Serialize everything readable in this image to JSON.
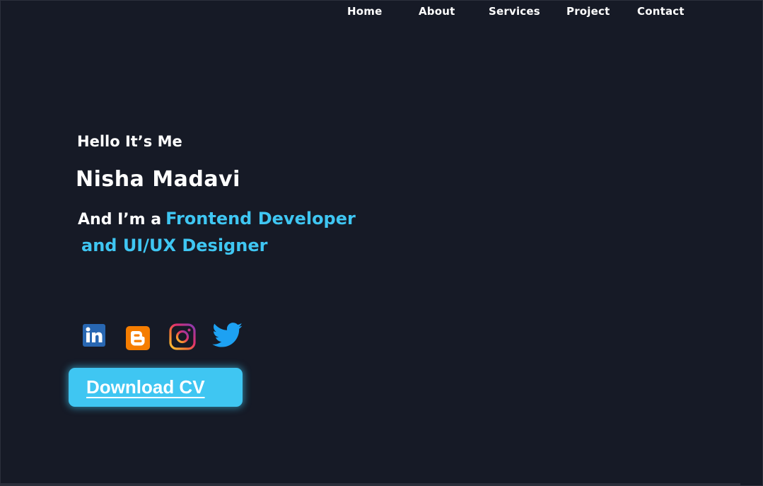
{
  "nav": {
    "items": [
      {
        "label": "Home"
      },
      {
        "label": "About"
      },
      {
        "label": "Services"
      },
      {
        "label": "Project"
      },
      {
        "label": "Contact"
      }
    ]
  },
  "hero": {
    "greeting": "Hello It’s Me",
    "name": "Nisha Madavi",
    "role_prefix": "And I’m a",
    "role_line1": "Frontend Developer",
    "role_line2": "and UI/UX Designer"
  },
  "social": [
    {
      "icon": "linkedin-icon",
      "color": "#2867b2"
    },
    {
      "icon": "blogger-icon",
      "color": "#f57d00"
    },
    {
      "icon": "instagram-icon",
      "color": "#e1306c"
    },
    {
      "icon": "twitter-icon",
      "color": "#1da1f2"
    }
  ],
  "cta": {
    "label": "Download CV"
  },
  "colors": {
    "background": "#161a26",
    "accent": "#3fc6f2",
    "text": "#ffffff"
  }
}
